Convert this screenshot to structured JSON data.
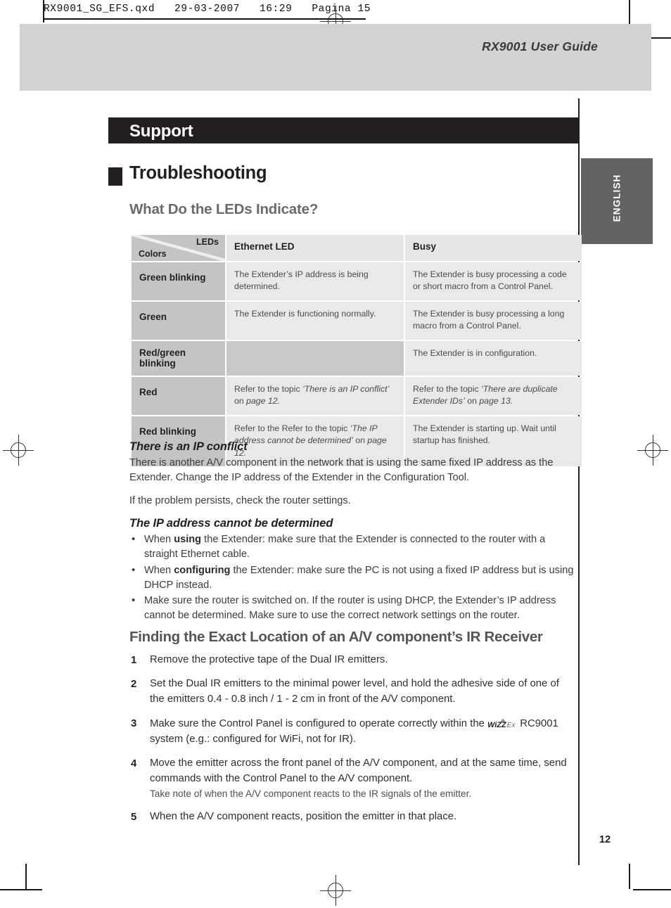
{
  "print_marks": {
    "file_header": "RX9001_SG_EFS.qxd   29-03-2007   16:29   Pagina 15"
  },
  "page": {
    "running_head": "RX9001 User Guide",
    "side_tab_label": "ENGLISH",
    "page_number": "12"
  },
  "banner": {
    "title": "Support"
  },
  "headings": {
    "chapter": "Troubleshooting",
    "section_leds": "What Do the LEDs Indicate?",
    "section_locating": "Finding the Exact Location of an A/V component’s IR Receiver"
  },
  "led_table": {
    "corner": {
      "top_right": "LEDs",
      "bottom_left": "Colors"
    },
    "columns": [
      "Ethernet LED",
      "Busy"
    ],
    "rows": [
      {
        "color": "Green blinking",
        "ethernet": "The Extender’s IP address is being determined.",
        "busy": "The Extender is busy processing a code or short macro from a Control Panel."
      },
      {
        "color": "Green",
        "ethernet": "The Extender is functioning normally.",
        "busy": "The Extender is busy processing a long macro from a Control Panel."
      },
      {
        "color": "Red/green blinking",
        "ethernet": "",
        "busy": "The Extender is in configuration."
      },
      {
        "color": "Red",
        "ethernet_parts": {
          "pre": "Refer to the topic ",
          "italic1": "‘There is an IP conflict’",
          "mid": " on ",
          "italic2": "page 12.",
          "post": ""
        },
        "busy_parts": {
          "pre": "Refer to the topic ",
          "italic1": "‘There are duplicate Extender IDs’",
          "mid": " on ",
          "italic2": "page 13.",
          "post": ""
        }
      },
      {
        "color": "Red blinking",
        "ethernet_parts": {
          "pre": "Refer to the Refer to the topic ",
          "italic1": "‘The IP address cannot be determined’",
          "mid": " on ",
          "italic2": "page 12.",
          "post": ""
        },
        "busy": "The Extender is starting up. Wait until startup has finished."
      }
    ]
  },
  "ip_conflict": {
    "heading": "There is an IP conflict",
    "paragraph1": "There is another A/V component in the network that is using the same fixed IP address as the Extender. Change the IP address of the Extender in the Configuration Tool.",
    "paragraph2": "If the problem persists, check the router settings."
  },
  "ip_undetermined": {
    "heading": "The IP address cannot be determined",
    "bullets": [
      {
        "pre": "When ",
        "bold": "using",
        "post": " the Extender: make sure that the Extender is connected to the router with a straight Ethernet cable."
      },
      {
        "pre": "When ",
        "bold": "configuring",
        "post": " the Extender: make sure the PC is not using a fixed IP address but is using DHCP instead."
      },
      {
        "pre": "",
        "bold": "",
        "post": "Make sure the router is switched on. If the router is using DHCP, the Extender’s IP address cannot be determined. Make sure to use the correct network settings on the router."
      }
    ]
  },
  "locating_steps": [
    {
      "text": "Remove the protective tape of the Dual IR emitters."
    },
    {
      "text": "Set the Dual IR emitters to the minimal power level, and hold the adhesive side of one of the emitters 0.4 - 0.8 inch / 1 - 2 cm in front of the A/V component."
    },
    {
      "text_before_logo": "Make sure the Control Panel is configured to operate correctly within the ",
      "logo_label": "WiZZ.Ex",
      "text_after_logo": " RC9001 system (e.g.: configured for WiFi, not for IR)."
    },
    {
      "text": "Move the emitter across the front panel of the A/V component, and at the same time, send commands with the Control Panel to the A/V component.",
      "subnote": "Take note of when the A/V component reacts to the IR signals of the emitter."
    },
    {
      "text": "When the A/V component reacts, position the emitter in that place."
    }
  ],
  "colors": {
    "banner_black": "#231f20",
    "band_gray": "#d2d2d2",
    "tab_gray": "#636363",
    "table_label_gray": "#c4c4c4",
    "table_body_gray": "#e9e9e9",
    "heading_gray": "#6a6a6a"
  }
}
